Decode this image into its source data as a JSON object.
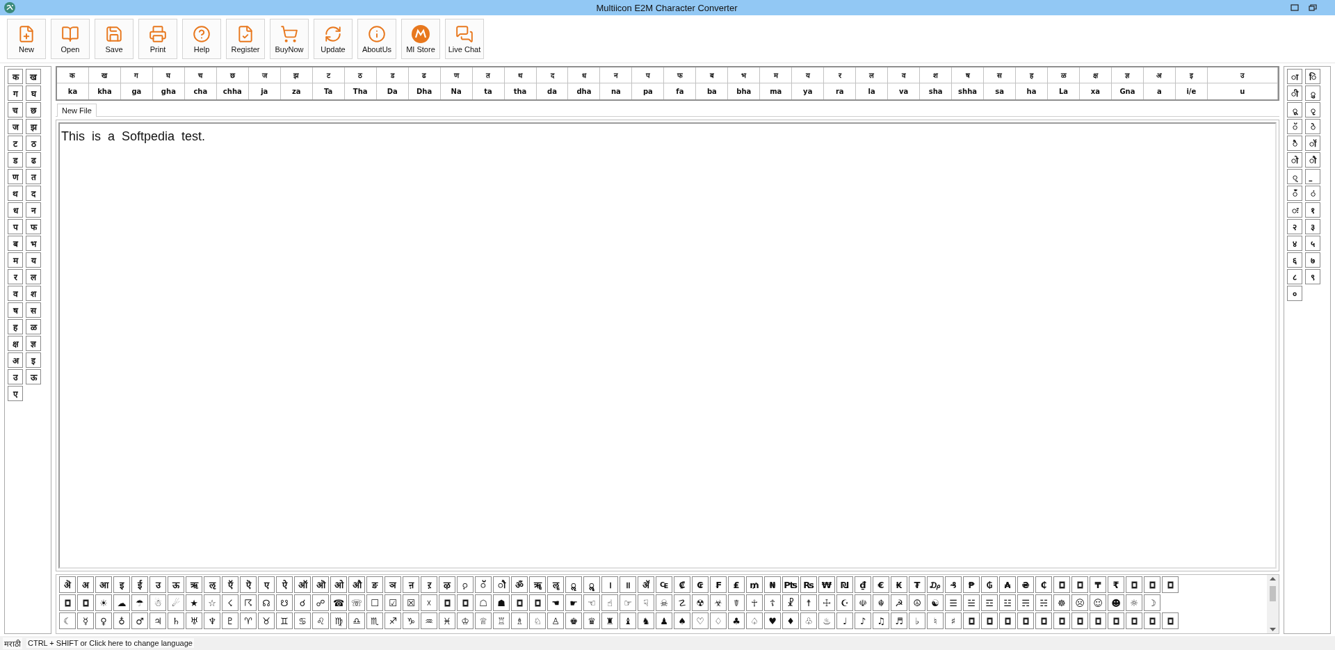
{
  "window": {
    "title": "Multiicon E2M Character Converter"
  },
  "toolbar": [
    {
      "label": "New"
    },
    {
      "label": "Open"
    },
    {
      "label": "Save"
    },
    {
      "label": "Print"
    },
    {
      "label": "Help"
    },
    {
      "label": "Register"
    },
    {
      "label": "BuyNow"
    },
    {
      "label": "Update"
    },
    {
      "label": "AboutUs"
    },
    {
      "label": "MI Store"
    },
    {
      "label": "Live Chat"
    }
  ],
  "consonants": [
    "क",
    "ख",
    "ग",
    "घ",
    "च",
    "छ",
    "ज",
    "झ",
    "ट",
    "ठ",
    "ड",
    "ढ",
    "ण",
    "त",
    "थ",
    "द",
    "ध",
    "न",
    "प",
    "फ",
    "ब",
    "भ",
    "म",
    "य",
    "र",
    "ल",
    "व",
    "श",
    "ष",
    "स",
    "ह",
    "ळ",
    "क्ष",
    "ज्ञ",
    "अ",
    "इ",
    "उ",
    "ऊ",
    "ए"
  ],
  "transliteration": [
    {
      "letter": "क",
      "roman": "ka"
    },
    {
      "letter": "ख",
      "roman": "kha"
    },
    {
      "letter": "ग",
      "roman": "ga"
    },
    {
      "letter": "घ",
      "roman": "gha"
    },
    {
      "letter": "च",
      "roman": "cha"
    },
    {
      "letter": "छ",
      "roman": "chha"
    },
    {
      "letter": "ज",
      "roman": "ja"
    },
    {
      "letter": "झ",
      "roman": "za"
    },
    {
      "letter": "ट",
      "roman": "Ta"
    },
    {
      "letter": "ठ",
      "roman": "Tha"
    },
    {
      "letter": "ड",
      "roman": "Da"
    },
    {
      "letter": "ढ",
      "roman": "Dha"
    },
    {
      "letter": "ण",
      "roman": "Na"
    },
    {
      "letter": "त",
      "roman": "ta"
    },
    {
      "letter": "थ",
      "roman": "tha"
    },
    {
      "letter": "द",
      "roman": "da"
    },
    {
      "letter": "ध",
      "roman": "dha"
    },
    {
      "letter": "न",
      "roman": "na"
    },
    {
      "letter": "प",
      "roman": "pa"
    },
    {
      "letter": "फ",
      "roman": "fa"
    },
    {
      "letter": "ब",
      "roman": "ba"
    },
    {
      "letter": "भ",
      "roman": "bha"
    },
    {
      "letter": "म",
      "roman": "ma"
    },
    {
      "letter": "य",
      "roman": "ya"
    },
    {
      "letter": "र",
      "roman": "ra"
    },
    {
      "letter": "ल",
      "roman": "la"
    },
    {
      "letter": "व",
      "roman": "va"
    },
    {
      "letter": "श",
      "roman": "sha"
    },
    {
      "letter": "ष",
      "roman": "shha"
    },
    {
      "letter": "स",
      "roman": "sa"
    },
    {
      "letter": "ह",
      "roman": "ha"
    },
    {
      "letter": "ळ",
      "roman": "La"
    },
    {
      "letter": "क्ष",
      "roman": "xa"
    },
    {
      "letter": "ज्ञ",
      "roman": "Gna"
    },
    {
      "letter": "अ",
      "roman": "a"
    },
    {
      "letter": "इ",
      "roman": "i/e"
    },
    {
      "letter": "उ",
      "roman": "u"
    }
  ],
  "signs": [
    "ा",
    "ि",
    "ी",
    "ु",
    "ू",
    "ृ",
    "ॅ",
    "े",
    "ै",
    "ॉ",
    "ो",
    "ौ",
    "्",
    "॒",
    "ँ",
    "ं",
    "ः",
    "१",
    "२",
    "३",
    "४",
    "५",
    "६",
    "७",
    "८",
    "९",
    "०"
  ],
  "editor": {
    "tabs": [
      {
        "label": "New File",
        "selected": true
      }
    ],
    "text": "This  is  a  Softpedia  test."
  },
  "symbols": [
    [
      {
        "kind": "glyph",
        "text": "ऄ"
      },
      {
        "kind": "glyph",
        "text": "अ"
      },
      {
        "kind": "glyph",
        "text": "आ"
      },
      {
        "kind": "glyph",
        "text": "इ"
      },
      {
        "kind": "glyph",
        "text": "ई"
      },
      {
        "kind": "glyph",
        "text": "उ"
      },
      {
        "kind": "glyph",
        "text": "ऊ"
      },
      {
        "kind": "glyph",
        "text": "ऋ"
      },
      {
        "kind": "glyph",
        "text": "ऌ"
      },
      {
        "kind": "glyph",
        "text": "ऍ"
      },
      {
        "kind": "glyph",
        "text": "ऎ"
      },
      {
        "kind": "glyph",
        "text": "ए"
      },
      {
        "kind": "glyph",
        "text": "ऐ"
      },
      {
        "kind": "glyph",
        "text": "ऑ"
      },
      {
        "kind": "glyph",
        "text": "ऒ"
      },
      {
        "kind": "glyph",
        "text": "ओ"
      },
      {
        "kind": "glyph",
        "text": "औ"
      },
      {
        "kind": "glyph",
        "text": "ङ"
      },
      {
        "kind": "glyph",
        "text": "ञ"
      },
      {
        "kind": "glyph",
        "text": "ऩ"
      },
      {
        "kind": "glyph",
        "text": "ऱ"
      },
      {
        "kind": "glyph",
        "text": "ऴ"
      },
      {
        "kind": "glyph",
        "text": "◌़"
      },
      {
        "kind": "glyph",
        "text": "◌ॅ"
      },
      {
        "kind": "glyph",
        "text": "◌ौ"
      },
      {
        "kind": "glyph",
        "text": "ॐ"
      },
      {
        "kind": "glyph",
        "text": "ॠ"
      },
      {
        "kind": "glyph",
        "text": "ॡ"
      },
      {
        "kind": "glyph",
        "text": "◌ॢ"
      },
      {
        "kind": "glyph",
        "text": "◌ॣ"
      },
      {
        "kind": "glyph",
        "text": "।"
      },
      {
        "kind": "glyph",
        "text": "॥"
      },
      {
        "kind": "glyph",
        "text": "ॲ"
      },
      {
        "kind": "glyph",
        "text": "₠"
      },
      {
        "kind": "glyph",
        "text": "₡"
      },
      {
        "kind": "glyph",
        "text": "₢"
      },
      {
        "kind": "glyph",
        "text": "₣"
      },
      {
        "kind": "glyph",
        "text": "₤"
      },
      {
        "kind": "glyph",
        "text": "₥"
      },
      {
        "kind": "glyph",
        "text": "₦"
      },
      {
        "kind": "glyph",
        "text": "₧"
      },
      {
        "kind": "glyph",
        "text": "₨"
      },
      {
        "kind": "glyph",
        "text": "₩"
      },
      {
        "kind": "glyph",
        "text": "₪"
      },
      {
        "kind": "glyph",
        "text": "₫"
      },
      {
        "kind": "glyph",
        "text": "€"
      },
      {
        "kind": "glyph",
        "text": "₭"
      },
      {
        "kind": "glyph",
        "text": "₮"
      },
      {
        "kind": "glyph",
        "text": "₯"
      },
      {
        "kind": "glyph",
        "text": "₰"
      },
      {
        "kind": "glyph",
        "text": "₱"
      },
      {
        "kind": "glyph",
        "text": "₲"
      },
      {
        "kind": "glyph",
        "text": "₳"
      },
      {
        "kind": "glyph",
        "text": "₴"
      },
      {
        "kind": "glyph",
        "text": "₵"
      },
      {
        "kind": "missing"
      },
      {
        "kind": "missing"
      },
      {
        "kind": "glyph",
        "text": "₸"
      },
      {
        "kind": "glyph",
        "text": "₹"
      },
      {
        "kind": "missing"
      },
      {
        "kind": "missing"
      },
      {
        "kind": "missing"
      }
    ],
    [
      {
        "kind": "missing"
      },
      {
        "kind": "missing"
      },
      {
        "kind": "glyph",
        "text": "☀"
      },
      {
        "kind": "glyph",
        "text": "☁"
      },
      {
        "kind": "glyph",
        "text": "☂"
      },
      {
        "kind": "glyph",
        "text": "☃"
      },
      {
        "kind": "glyph",
        "text": "☄"
      },
      {
        "kind": "glyph",
        "text": "★"
      },
      {
        "kind": "glyph",
        "text": "☆"
      },
      {
        "kind": "glyph",
        "text": "☇"
      },
      {
        "kind": "glyph",
        "text": "☈"
      },
      {
        "kind": "glyph",
        "text": "☊"
      },
      {
        "kind": "glyph",
        "text": "☋"
      },
      {
        "kind": "glyph",
        "text": "☌"
      },
      {
        "kind": "glyph",
        "text": "☍"
      },
      {
        "kind": "glyph",
        "text": "☎"
      },
      {
        "kind": "glyph",
        "text": "☏"
      },
      {
        "kind": "glyph",
        "text": "☐"
      },
      {
        "kind": "glyph",
        "text": "☑"
      },
      {
        "kind": "glyph",
        "text": "☒"
      },
      {
        "kind": "glyph",
        "text": "☓"
      },
      {
        "kind": "missing"
      },
      {
        "kind": "missing"
      },
      {
        "kind": "glyph",
        "text": "☖"
      },
      {
        "kind": "glyph",
        "text": "☗"
      },
      {
        "kind": "missing"
      },
      {
        "kind": "missing"
      },
      {
        "kind": "glyph",
        "text": "☚"
      },
      {
        "kind": "glyph",
        "text": "☛"
      },
      {
        "kind": "glyph",
        "text": "☜"
      },
      {
        "kind": "glyph",
        "text": "☝"
      },
      {
        "kind": "glyph",
        "text": "☞"
      },
      {
        "kind": "glyph",
        "text": "☟"
      },
      {
        "kind": "glyph",
        "text": "☠"
      },
      {
        "kind": "glyph",
        "text": "☡"
      },
      {
        "kind": "glyph",
        "text": "☢"
      },
      {
        "kind": "glyph",
        "text": "☣"
      },
      {
        "kind": "glyph",
        "text": "☤"
      },
      {
        "kind": "glyph",
        "text": "☥"
      },
      {
        "kind": "glyph",
        "text": "☦"
      },
      {
        "kind": "glyph",
        "text": "☧"
      },
      {
        "kind": "glyph",
        "text": "☨"
      },
      {
        "kind": "glyph",
        "text": "☩"
      },
      {
        "kind": "glyph",
        "text": "☪"
      },
      {
        "kind": "glyph",
        "text": "☫"
      },
      {
        "kind": "glyph",
        "text": "☬"
      },
      {
        "kind": "glyph",
        "text": "☭"
      },
      {
        "kind": "glyph",
        "text": "☮"
      },
      {
        "kind": "glyph",
        "text": "☯"
      },
      {
        "kind": "glyph",
        "text": "☰"
      },
      {
        "kind": "glyph",
        "text": "☱"
      },
      {
        "kind": "glyph",
        "text": "☲"
      },
      {
        "kind": "glyph",
        "text": "☳"
      },
      {
        "kind": "glyph",
        "text": "☴"
      },
      {
        "kind": "glyph",
        "text": "☵"
      },
      {
        "kind": "glyph",
        "text": "☸"
      },
      {
        "kind": "glyph",
        "text": "☹"
      },
      {
        "kind": "glyph",
        "text": "☺"
      },
      {
        "kind": "glyph",
        "text": "☻"
      },
      {
        "kind": "glyph",
        "text": "☼"
      },
      {
        "kind": "glyph",
        "text": "☽"
      }
    ],
    [
      {
        "kind": "glyph",
        "text": "☾"
      },
      {
        "kind": "glyph",
        "text": "☿"
      },
      {
        "kind": "glyph",
        "text": "♀"
      },
      {
        "kind": "glyph",
        "text": "♁"
      },
      {
        "kind": "glyph",
        "text": "♂"
      },
      {
        "kind": "glyph",
        "text": "♃"
      },
      {
        "kind": "glyph",
        "text": "♄"
      },
      {
        "kind": "glyph",
        "text": "♅"
      },
      {
        "kind": "glyph",
        "text": "♆"
      },
      {
        "kind": "glyph",
        "text": "♇"
      },
      {
        "kind": "glyph",
        "text": "♈"
      },
      {
        "kind": "glyph",
        "text": "♉"
      },
      {
        "kind": "glyph",
        "text": "♊"
      },
      {
        "kind": "glyph",
        "text": "♋"
      },
      {
        "kind": "glyph",
        "text": "♌"
      },
      {
        "kind": "glyph",
        "text": "♍"
      },
      {
        "kind": "glyph",
        "text": "♎"
      },
      {
        "kind": "glyph",
        "text": "♏"
      },
      {
        "kind": "glyph",
        "text": "♐"
      },
      {
        "kind": "glyph",
        "text": "♑"
      },
      {
        "kind": "glyph",
        "text": "♒"
      },
      {
        "kind": "glyph",
        "text": "♓"
      },
      {
        "kind": "glyph",
        "text": "♔"
      },
      {
        "kind": "glyph",
        "text": "♕"
      },
      {
        "kind": "glyph",
        "text": "♖"
      },
      {
        "kind": "glyph",
        "text": "♗"
      },
      {
        "kind": "glyph",
        "text": "♘"
      },
      {
        "kind": "glyph",
        "text": "♙"
      },
      {
        "kind": "glyph",
        "text": "♚"
      },
      {
        "kind": "glyph",
        "text": "♛"
      },
      {
        "kind": "glyph",
        "text": "♜"
      },
      {
        "kind": "glyph",
        "text": "♝"
      },
      {
        "kind": "glyph",
        "text": "♞"
      },
      {
        "kind": "glyph",
        "text": "♟"
      },
      {
        "kind": "glyph",
        "text": "♠"
      },
      {
        "kind": "glyph",
        "text": "♡"
      },
      {
        "kind": "glyph",
        "text": "♢"
      },
      {
        "kind": "glyph",
        "text": "♣"
      },
      {
        "kind": "glyph",
        "text": "♤"
      },
      {
        "kind": "glyph",
        "text": "♥"
      },
      {
        "kind": "glyph",
        "text": "♦"
      },
      {
        "kind": "glyph",
        "text": "♧"
      },
      {
        "kind": "glyph",
        "text": "♨"
      },
      {
        "kind": "glyph",
        "text": "♩"
      },
      {
        "kind": "glyph",
        "text": "♪"
      },
      {
        "kind": "glyph",
        "text": "♫"
      },
      {
        "kind": "glyph",
        "text": "♬"
      },
      {
        "kind": "glyph",
        "text": "♭"
      },
      {
        "kind": "glyph",
        "text": "♮"
      },
      {
        "kind": "glyph",
        "text": "♯"
      },
      {
        "kind": "missing"
      },
      {
        "kind": "missing"
      },
      {
        "kind": "missing"
      },
      {
        "kind": "missing"
      },
      {
        "kind": "missing"
      },
      {
        "kind": "missing"
      },
      {
        "kind": "missing"
      },
      {
        "kind": "missing"
      },
      {
        "kind": "missing"
      },
      {
        "kind": "missing"
      },
      {
        "kind": "missing"
      },
      {
        "kind": "missing"
      }
    ]
  ],
  "status_bar": {
    "language": "मराठी",
    "hint": "CTRL + SHIFT or Click here to change language"
  }
}
